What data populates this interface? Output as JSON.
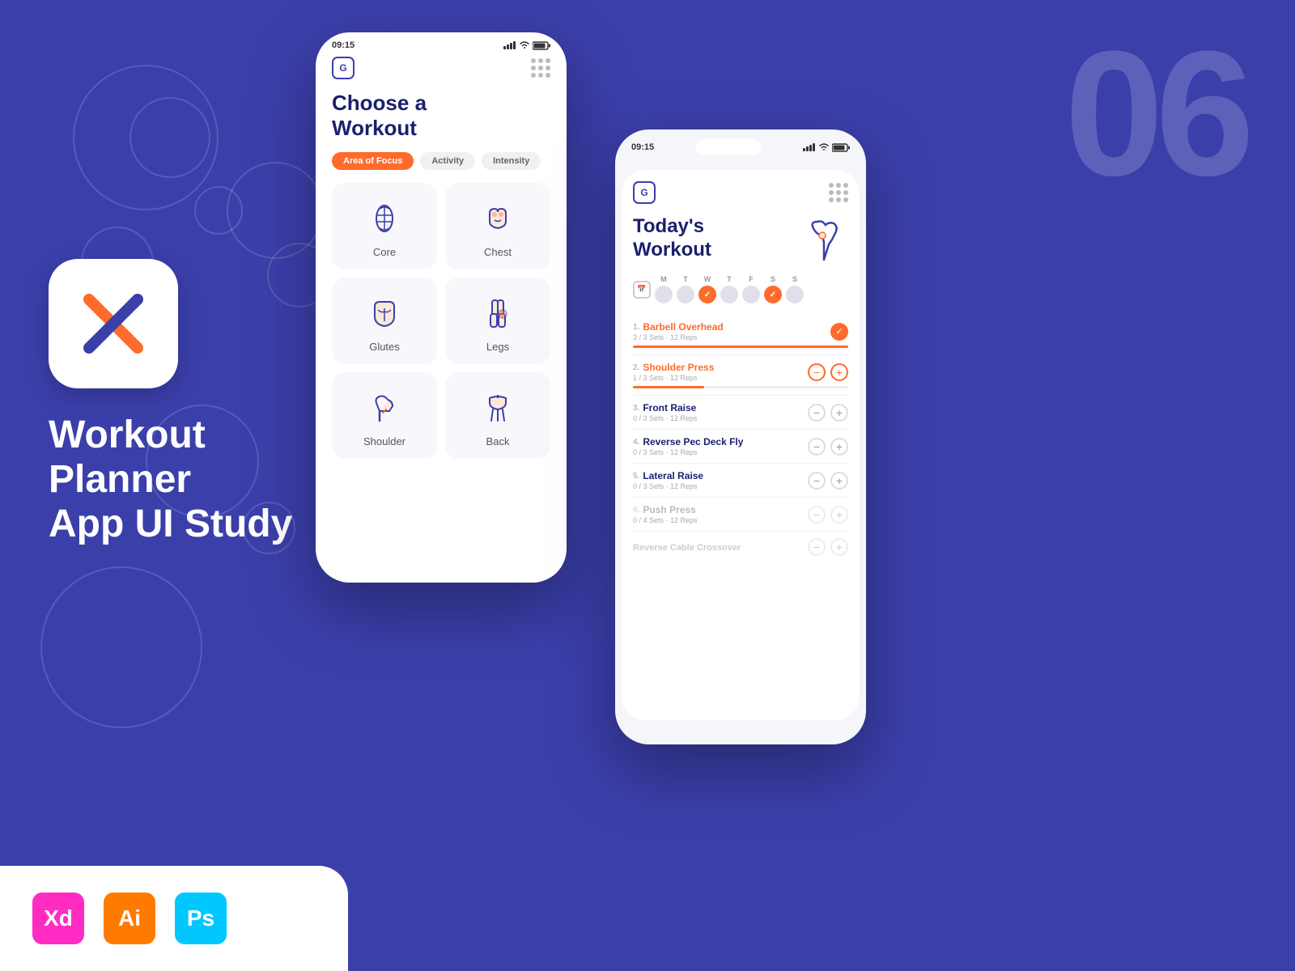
{
  "app": {
    "large_number": "06",
    "brand": {
      "title_line1": "Workout",
      "title_line2": "Planner",
      "title_line3": "App UI Study"
    },
    "tools": [
      {
        "name": "XD",
        "label": "Xd",
        "class": "xd"
      },
      {
        "name": "AI",
        "label": "Ai",
        "class": "ai"
      },
      {
        "name": "PS",
        "label": "Ps",
        "class": "ps"
      }
    ]
  },
  "phone1": {
    "status_time": "09:15",
    "header_logo": "G",
    "title": "Choose a\nWorkout",
    "filters": [
      {
        "label": "Area of Focus",
        "active": true
      },
      {
        "label": "Activity",
        "active": false
      },
      {
        "label": "Intensity",
        "active": false
      }
    ],
    "workouts": [
      {
        "label": "Core",
        "icon": "core"
      },
      {
        "label": "Chest",
        "icon": "chest"
      },
      {
        "label": "Glutes",
        "icon": "glutes"
      },
      {
        "label": "Legs",
        "icon": "legs"
      },
      {
        "label": "Shoulder",
        "icon": "shoulder"
      },
      {
        "label": "Back",
        "icon": "back"
      }
    ]
  },
  "phone2": {
    "status_time": "09:15",
    "header_logo": "G",
    "title_line1": "Today's",
    "title_line2": "Workout",
    "week_days": [
      "M",
      "T",
      "W",
      "T",
      "F",
      "S",
      "S"
    ],
    "week_active": [
      false,
      false,
      true,
      false,
      false,
      true,
      false
    ],
    "exercises": [
      {
        "num": "1.",
        "name": "Barbell Overhead",
        "meta": "3 / 3 Sets · 12 Reps",
        "progress": 100,
        "status": "done",
        "color": "orange"
      },
      {
        "num": "2.",
        "name": "Shoulder Press",
        "meta": "1 / 3 Sets · 12 Reps",
        "progress": 33,
        "status": "partial",
        "color": "orange"
      },
      {
        "num": "3.",
        "name": "Front Raise",
        "meta": "0 / 3 Sets · 12 Reps",
        "progress": 0,
        "status": "normal",
        "color": "normal"
      },
      {
        "num": "4.",
        "name": "Reverse Pec Deck Fly",
        "meta": "0 / 3 Sets · 12 Reps",
        "progress": 0,
        "status": "normal",
        "color": "normal"
      },
      {
        "num": "5.",
        "name": "Lateral Raise",
        "meta": "0 / 3 Sets · 12 Reps",
        "progress": 0,
        "status": "normal",
        "color": "normal"
      },
      {
        "num": "6.",
        "name": "Push Press",
        "meta": "0 / 4 Sets · 12 Reps",
        "progress": 0,
        "status": "dim",
        "color": "dim"
      },
      {
        "num": "",
        "name": "Reverse Cable Crossover",
        "meta": "",
        "progress": 0,
        "status": "dim",
        "color": "dim"
      }
    ]
  }
}
